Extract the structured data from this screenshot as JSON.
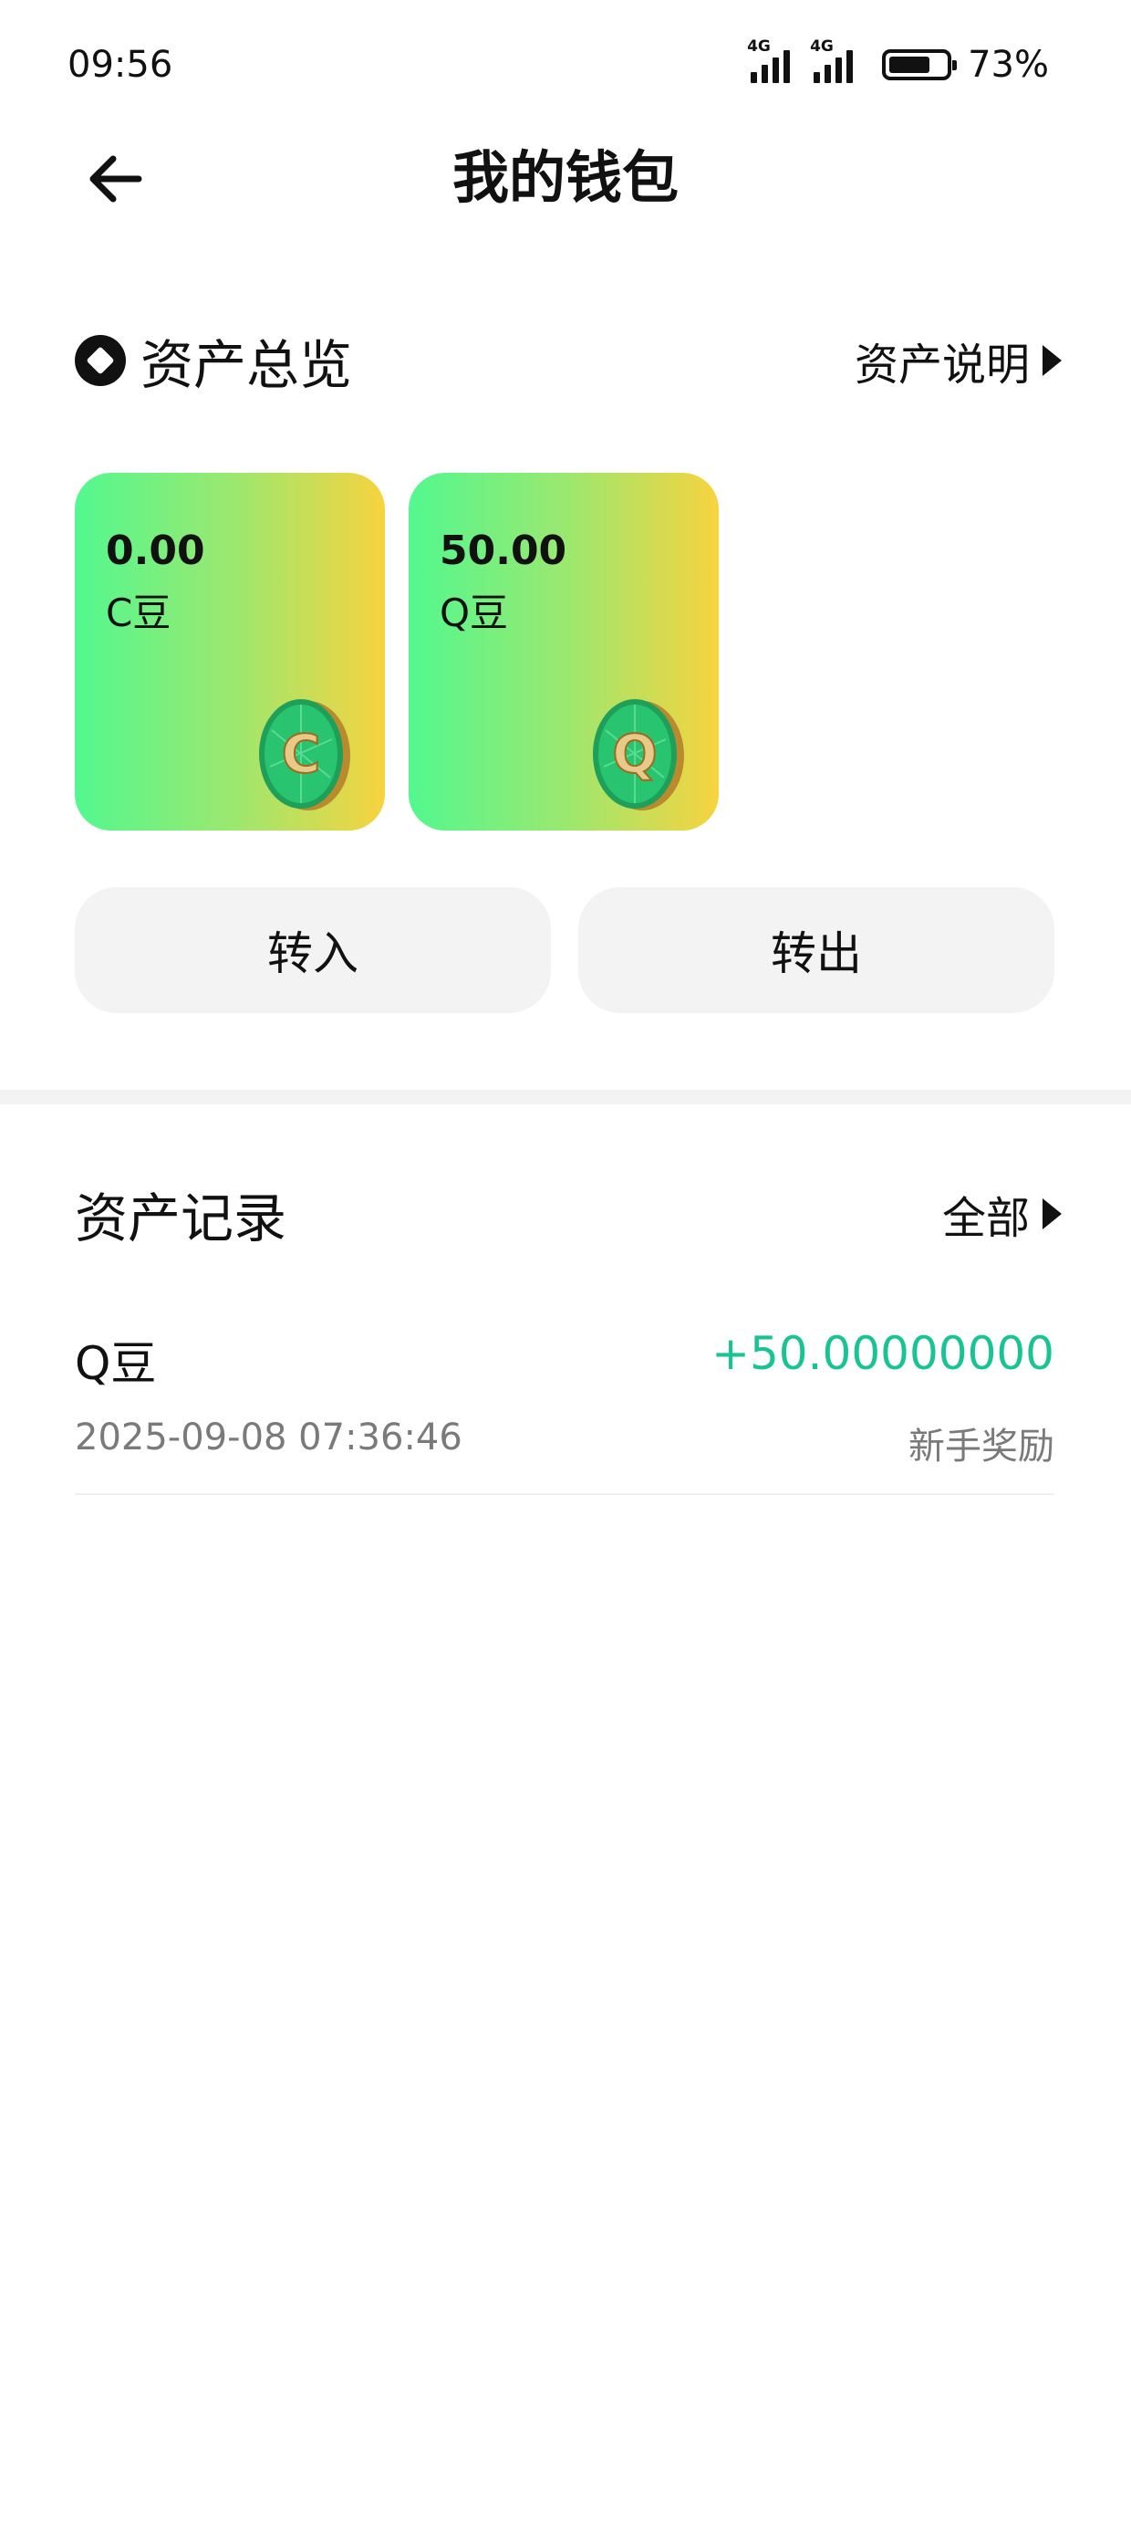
{
  "status_bar": {
    "time": "09:56",
    "network_1": "4G",
    "network_2": "4G",
    "battery_percent": "73%",
    "battery_level": 0.73
  },
  "header": {
    "title": "我的钱包",
    "back_icon": "arrow-left-icon"
  },
  "overview": {
    "title": "资产总览",
    "link_label": "资产说明",
    "cards": [
      {
        "amount": "0.00",
        "name": "C豆",
        "coin_letter": "C"
      },
      {
        "amount": "50.00",
        "name": "Q豆",
        "coin_letter": "Q"
      }
    ],
    "buttons": {
      "transfer_in": "转入",
      "transfer_out": "转出"
    }
  },
  "records": {
    "title": "资产记录",
    "filter_label": "全部",
    "items": [
      {
        "name": "Q豆",
        "amount": "+50.00000000",
        "time": "2025-09-08 07:36:46",
        "note": "新手奖励"
      }
    ]
  },
  "colors": {
    "card_gradient_start": "#52f88f",
    "card_gradient_end": "#f7d33f",
    "positive_amount": "#19c493",
    "button_bg": "#f3f3f3"
  }
}
